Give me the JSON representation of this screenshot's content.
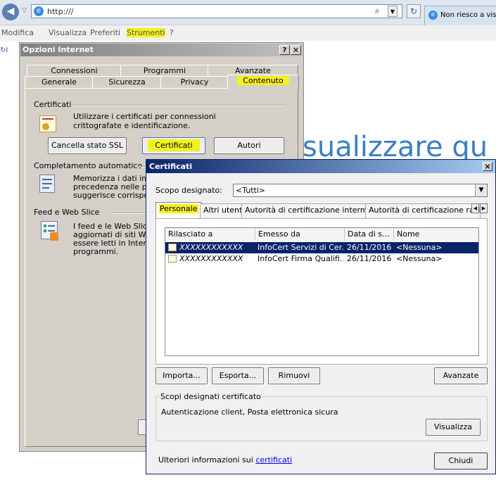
{
  "browser": {
    "address": "http:///",
    "tab_title": "Non riesco a visu",
    "bg_text": "sualizzare qu",
    "menu": [
      "Modifica",
      "Visualizza",
      "Preferiti",
      "Strumenti",
      "?"
    ]
  },
  "inet_options": {
    "title": "Opzioni Internet",
    "tabs_back": [
      "Connessioni",
      "Programmi",
      "Avanzate"
    ],
    "tabs_front": [
      "Generale",
      "Sicurezza",
      "Privacy",
      "Contenuto"
    ],
    "cert_group": "Certificati",
    "cert_text": "Utilizzare i certificati per connessioni crittografate e identificazione.",
    "btn_ssl": "Cancella stato SSL",
    "btn_cert": "Certificati",
    "btn_authors": "Autori",
    "autocomplete_group": "Completamento automatico",
    "autocomplete_text": [
      "Memorizza i dati immes",
      "precedenza nelle pagi",
      "suggerisce corrispond"
    ],
    "feeds_group": "Feed e Web Slice",
    "feeds_text": [
      "I feed e le Web Slice c",
      "aggiornati di siti Web c",
      "essere letti in Internet",
      "programmi."
    ]
  },
  "certificates": {
    "title": "Certificati",
    "close_glyph": "×",
    "scope_label": "Scopo designato:",
    "scope_value": "<Tutti>",
    "tabs": [
      "Personale",
      "Altri utenti",
      "Autorità di certificazione intermedie",
      "Autorità di certificazione radi"
    ],
    "columns": [
      "Rilasciato a",
      "Emesso da",
      "Data di s...",
      "Nome"
    ],
    "rows": [
      {
        "issued_to": "XXXXXXXXXXXX",
        "issued_by": "InfoCert Servizi di Cer...",
        "date": "26/11/2016",
        "name": "<Nessuna>"
      },
      {
        "issued_to": "XXXXXXXXXXXX",
        "issued_by": "InfoCert Firma Qualifi...",
        "date": "26/11/2016",
        "name": "<Nessuna>"
      }
    ],
    "btn_import": "Importa...",
    "btn_export": "Esporta...",
    "btn_remove": "Rimuovi",
    "btn_advanced": "Avanzate",
    "purposes_group": "Scopi designati certificato",
    "purposes_text": "Autenticazione client, Posta elettronica sicura",
    "btn_view": "Visualizza",
    "footer_text": "Ulteriori informazioni sui",
    "footer_link": "certificati",
    "btn_close": "Chiudi"
  },
  "colors": {
    "highlight": "#f2f21e",
    "selection": "#0a246a",
    "titlebar_classic": "#a9a9a9",
    "link": "#0000ee"
  }
}
